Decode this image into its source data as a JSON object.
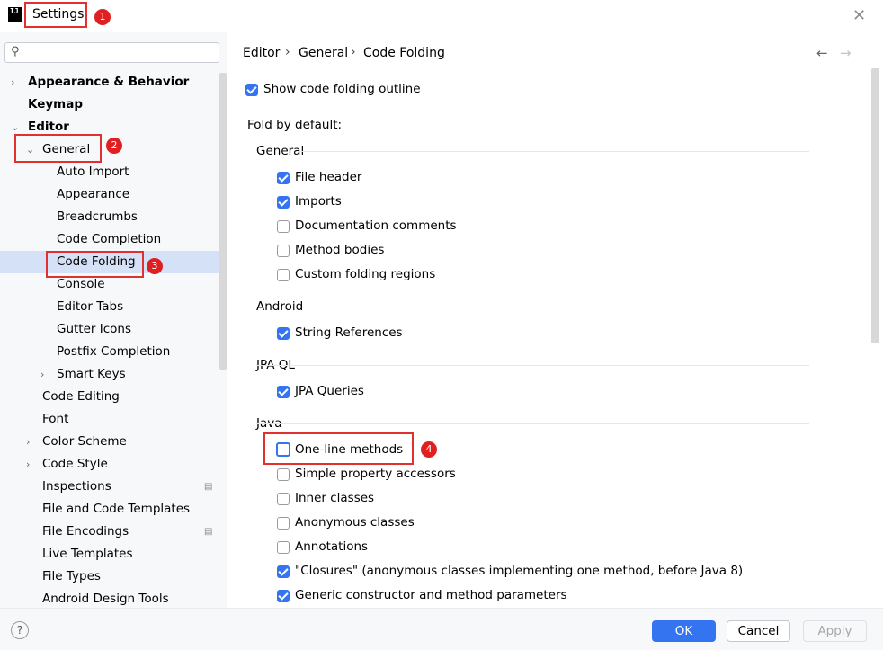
{
  "window": {
    "title": "Settings",
    "logo_text": "IJ",
    "close_glyph": "✕"
  },
  "annotations": [
    "1",
    "2",
    "3",
    "4"
  ],
  "search": {
    "placeholder": "",
    "icon": "search-icon"
  },
  "sidebar": {
    "items": [
      {
        "label": "Appearance & Behavior",
        "bold": true,
        "chevron": "right"
      },
      {
        "label": "Keymap",
        "bold": true
      },
      {
        "label": "Editor",
        "bold": true,
        "chevron": "down"
      },
      {
        "label": "General",
        "chevron": "down"
      },
      {
        "label": "Auto Import"
      },
      {
        "label": "Appearance"
      },
      {
        "label": "Breadcrumbs"
      },
      {
        "label": "Code Completion"
      },
      {
        "label": "Code Folding",
        "selected": true
      },
      {
        "label": "Console"
      },
      {
        "label": "Editor Tabs"
      },
      {
        "label": "Gutter Icons"
      },
      {
        "label": "Postfix Completion"
      },
      {
        "label": "Smart Keys",
        "chevron": "right"
      },
      {
        "label": "Code Editing"
      },
      {
        "label": "Font"
      },
      {
        "label": "Color Scheme",
        "chevron": "right"
      },
      {
        "label": "Code Style",
        "chevron": "right"
      },
      {
        "label": "Inspections",
        "icon": "list-icon"
      },
      {
        "label": "File and Code Templates"
      },
      {
        "label": "File Encodings",
        "icon": "list-icon"
      },
      {
        "label": "Live Templates"
      },
      {
        "label": "File Types"
      },
      {
        "label": "Android Design Tools"
      }
    ]
  },
  "breadcrumb": {
    "items": [
      "Editor",
      "General",
      "Code Folding"
    ],
    "separator": "›",
    "back": "←",
    "forward": "→"
  },
  "main": {
    "show_outline": {
      "label": "Show code folding outline",
      "checked": true
    },
    "fold_by_default": "Fold by default:",
    "sections": [
      {
        "title": "General",
        "options": [
          {
            "label": "File header",
            "checked": true
          },
          {
            "label": "Imports",
            "checked": true
          },
          {
            "label": "Documentation comments",
            "checked": false
          },
          {
            "label": "Method bodies",
            "checked": false
          },
          {
            "label": "Custom folding regions",
            "checked": false
          }
        ]
      },
      {
        "title": "Android",
        "options": [
          {
            "label": "String References",
            "checked": true
          }
        ]
      },
      {
        "title": "JPA QL",
        "options": [
          {
            "label": "JPA Queries",
            "checked": true
          }
        ]
      },
      {
        "title": "Java",
        "options": [
          {
            "label": "One-line methods",
            "checked": false,
            "focused": true
          },
          {
            "label": "Simple property accessors",
            "checked": false
          },
          {
            "label": "Inner classes",
            "checked": false
          },
          {
            "label": "Anonymous classes",
            "checked": false
          },
          {
            "label": "Annotations",
            "checked": false
          },
          {
            "label": "\"Closures\" (anonymous classes implementing one method, before Java 8)",
            "checked": true
          },
          {
            "label": "Generic constructor and method parameters",
            "checked": true
          }
        ]
      }
    ]
  },
  "footer": {
    "help": "?",
    "ok": "OK",
    "cancel": "Cancel",
    "apply": "Apply"
  },
  "colors": {
    "accent": "#3574f0",
    "annotation": "#e03030",
    "selection": "#d5e1f7"
  }
}
